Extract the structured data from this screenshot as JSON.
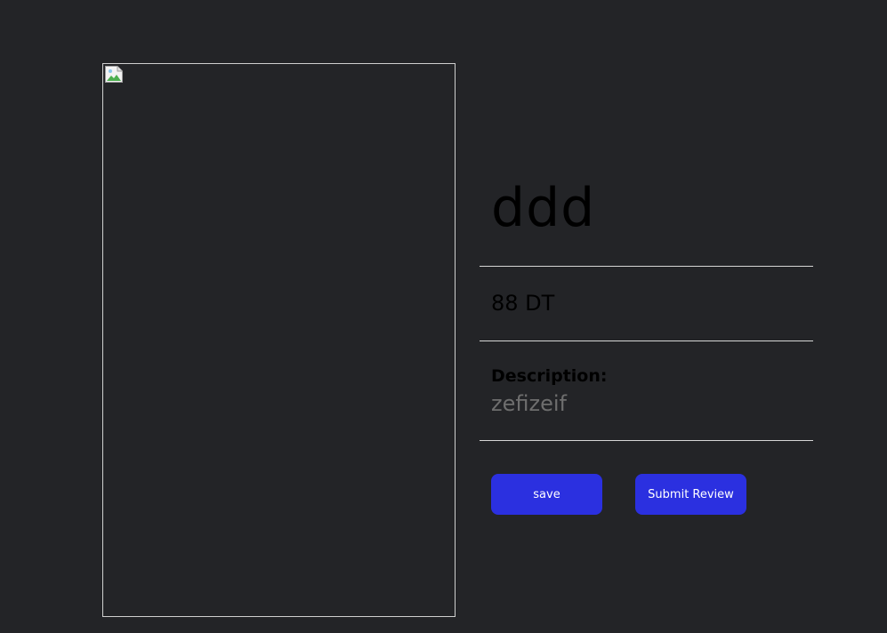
{
  "product": {
    "title": "ddd",
    "price": "88 DT",
    "description_label": "Description:",
    "description": "zefizeif",
    "image_icon": "broken-image-icon"
  },
  "actions": {
    "save_label": "save",
    "submit_review_label": "Submit Review"
  },
  "colors": {
    "background": "#232427",
    "button": "#2b30e0",
    "button_text": "#ffffff",
    "description_text": "#6e6e6e"
  }
}
